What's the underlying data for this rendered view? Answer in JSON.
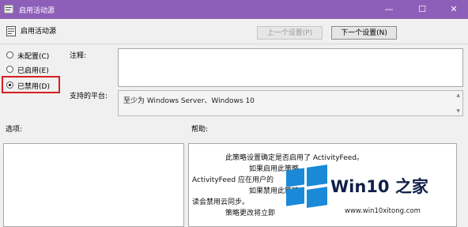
{
  "window": {
    "title": "启用活动源",
    "controls": {
      "minimize": "—",
      "maximize": "☐",
      "close": "✕"
    }
  },
  "header": {
    "policy_title": "启用活动源",
    "prev_button": "上一个设置(P)",
    "next_button": "下一个设置(N)"
  },
  "options": {
    "not_configured": "未配置(C)",
    "enabled": "已启用(E)",
    "disabled": "已禁用(D)",
    "selected": "disabled"
  },
  "comment": {
    "label": "注释:",
    "value": ""
  },
  "supported": {
    "label": "支持的平台:",
    "value": "至少为 Windows Server、Windows 10"
  },
  "panels": {
    "options_label": "选项:",
    "help_label": "帮助:",
    "help_lines": [
      "此策略设置确定是否启用了 ActivityFeed。",
      "如果启用此策略",
      "ActivityFeed 应在用户的",
      "如果禁用此策略",
      "读会禁用云同步。",
      "策略更改将立即"
    ]
  },
  "watermark": {
    "brand": "Win10 之家",
    "url": "www.win10xitong.com"
  },
  "colors": {
    "titlebar": "#8e5fb8",
    "highlight": "#d81e1e",
    "logo_blue": "#1a8ad8"
  }
}
